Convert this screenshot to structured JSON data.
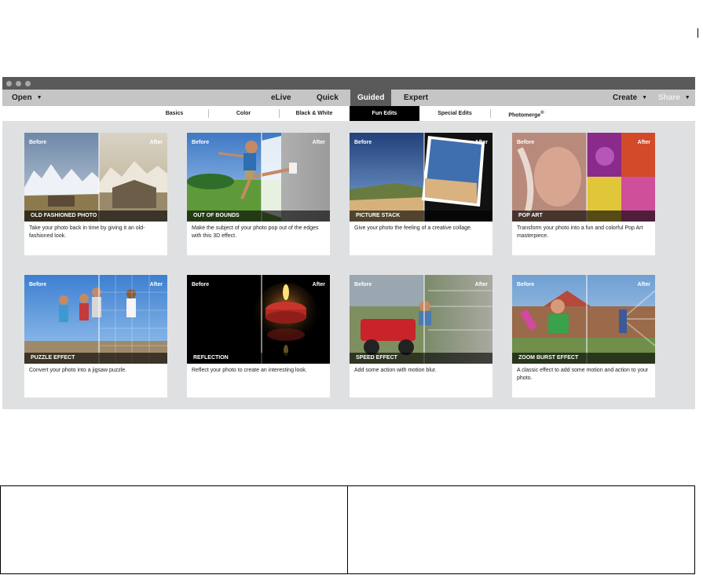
{
  "menubar": {
    "open_label": "Open",
    "create_label": "Create",
    "share_label": "Share",
    "modes": [
      "eLive",
      "Quick",
      "Guided",
      "Expert"
    ],
    "active_mode": "Guided"
  },
  "subnav": {
    "tabs": [
      "Basics",
      "Color",
      "Black & White",
      "Fun Edits",
      "Special Edits",
      "Photomerge"
    ],
    "photomerge_mark": "®",
    "active_tab": "Fun Edits"
  },
  "labels": {
    "before": "Before",
    "after": "After"
  },
  "cards": [
    {
      "title": "OLD FASHIONED PHOTO",
      "description": "Take your photo back in time by giving it an old-fashioned look."
    },
    {
      "title": "OUT OF BOUNDS",
      "description": "Make the subject of your photo pop out of the edges with this 3D effect."
    },
    {
      "title": "PICTURE STACK",
      "description": "Give your photo the feeling of a creative collage."
    },
    {
      "title": "POP ART",
      "description": "Transform your photo into a fun and colorful Pop Art masterpiece."
    },
    {
      "title": "PUZZLE EFFECT",
      "description": "Convert your photo into a jigsaw puzzle."
    },
    {
      "title": "REFLECTION",
      "description": "Reflect your photo to create an interesting look."
    },
    {
      "title": "SPEED EFFECT",
      "description": "Add some action with motion blur."
    },
    {
      "title": "ZOOM BURST EFFECT",
      "description": "A classic effect to add some motion and action to your photo."
    }
  ],
  "colors": {
    "active_tab_bg": "#5a5a5a",
    "app_bg": "#dfe0e2",
    "fun_edits_bg": "#000000"
  }
}
